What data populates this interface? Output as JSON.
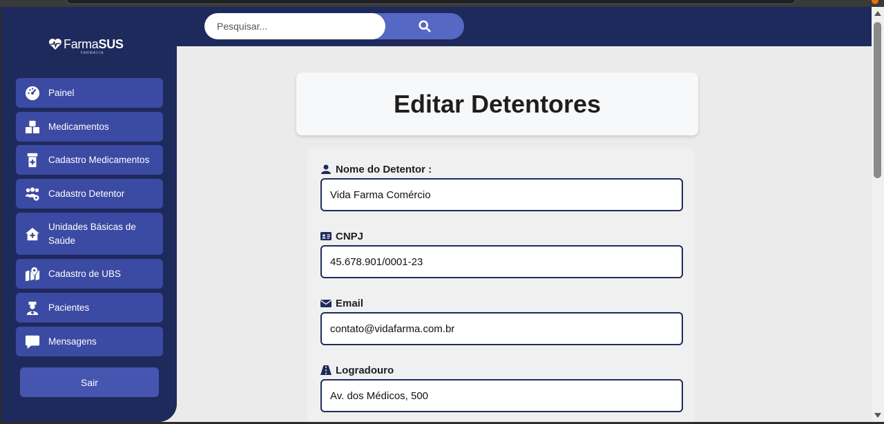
{
  "logo": {
    "brand_light": "Farma",
    "brand_bold": "SUS",
    "subtitle": "FARMÁCIA"
  },
  "sidebar": {
    "items": [
      {
        "label": "Painel",
        "icon": "gauge-icon"
      },
      {
        "label": "Medicamentos",
        "icon": "boxes-icon"
      },
      {
        "label": "Cadastro Medicamentos",
        "icon": "prescription-bottle-icon"
      },
      {
        "label": "Cadastro Detentor",
        "icon": "users-gear-icon"
      },
      {
        "label": "Unidades Básicas de Saúde",
        "icon": "house-medical-icon"
      },
      {
        "label": "Cadastro de UBS",
        "icon": "map-location-icon"
      },
      {
        "label": "Pacientes",
        "icon": "user-nurse-icon"
      },
      {
        "label": "Mensagens",
        "icon": "message-icon"
      }
    ],
    "logout_label": "Sair"
  },
  "search": {
    "placeholder": "Pesquisar...",
    "icon": "search-icon"
  },
  "page": {
    "title": "Editar Detentores"
  },
  "form": {
    "fields": [
      {
        "label": "Nome do Detentor :",
        "value": "Vida Farma Comércio",
        "icon": "user-icon"
      },
      {
        "label": "CNPJ",
        "value": "45.678.901/0001-23",
        "icon": "id-card-icon"
      },
      {
        "label": "Email",
        "value": "contato@vidafarma.com.br",
        "icon": "envelope-icon"
      },
      {
        "label": "Logradouro",
        "value": "Av. dos Médicos, 500",
        "icon": "road-icon"
      }
    ]
  },
  "colors": {
    "navy": "#1f2a5c",
    "nav_item": "#3b4aa3",
    "search_button": "#5468c4",
    "background": "#ebebeb"
  }
}
